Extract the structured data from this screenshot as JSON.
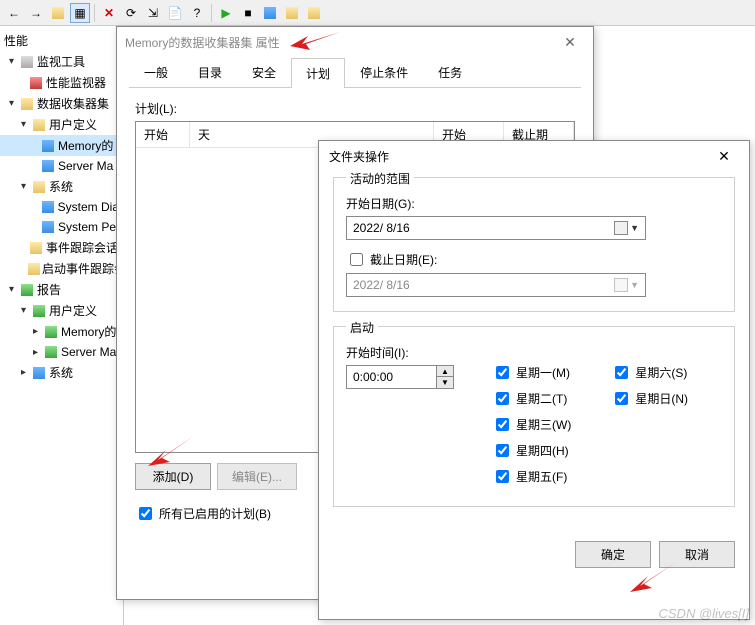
{
  "toolbar_icons": [
    "back",
    "fwd",
    "up",
    "table",
    "x",
    "refresh",
    "export",
    "doc",
    "help",
    "play",
    "stop",
    "square",
    "save",
    "add"
  ],
  "tree": {
    "root": "性能",
    "monitor_tools": "监视工具",
    "perf_monitor": "性能监视器",
    "collector_sets": "数据收集器集",
    "user_defined": "用户定义",
    "memory_set": "Memory的",
    "server_ma": "Server Ma",
    "system": "系统",
    "system_dia": "System Dia",
    "system_pe": "System Pe",
    "event_trace": "事件跟踪会话",
    "startup_trace": "启动事件跟踪会",
    "reports": "报告",
    "user_defined2": "用户定义",
    "memory_set2": "Memory的",
    "server_ma2": "Server Ma",
    "system2": "系统"
  },
  "dialog1": {
    "title": "Memory的数据收集器集 属性",
    "tabs": {
      "general": "一般",
      "directory": "目录",
      "security": "安全",
      "schedule": "计划",
      "stop": "停止条件",
      "task": "任务"
    },
    "schedule_label": "计划(L):",
    "cols": {
      "start": "开始",
      "day": "天",
      "start2": "开始",
      "deadline": "截止期"
    },
    "add_btn": "添加(D)",
    "edit_btn": "编辑(E)...",
    "all_enabled": "所有已启用的计划(B)"
  },
  "dialog2": {
    "title": "文件夹操作",
    "group_range": "活动的范围",
    "start_date_lbl": "开始日期(G):",
    "start_date_val": "2022/ 8/16",
    "end_date_lbl": "截止日期(E):",
    "end_date_val": "2022/ 8/16",
    "group_launch": "启动",
    "start_time_lbl": "开始时间(I):",
    "start_time_val": "0:00:00",
    "days": {
      "mon": "星期一(M)",
      "tue": "星期二(T)",
      "wed": "星期三(W)",
      "thu": "星期四(H)",
      "fri": "星期五(F)",
      "sat": "星期六(S)",
      "sun": "星期日(N)"
    },
    "ok": "确定",
    "cancel": "取消"
  },
  "watermark": "CSDN @lives[I]"
}
